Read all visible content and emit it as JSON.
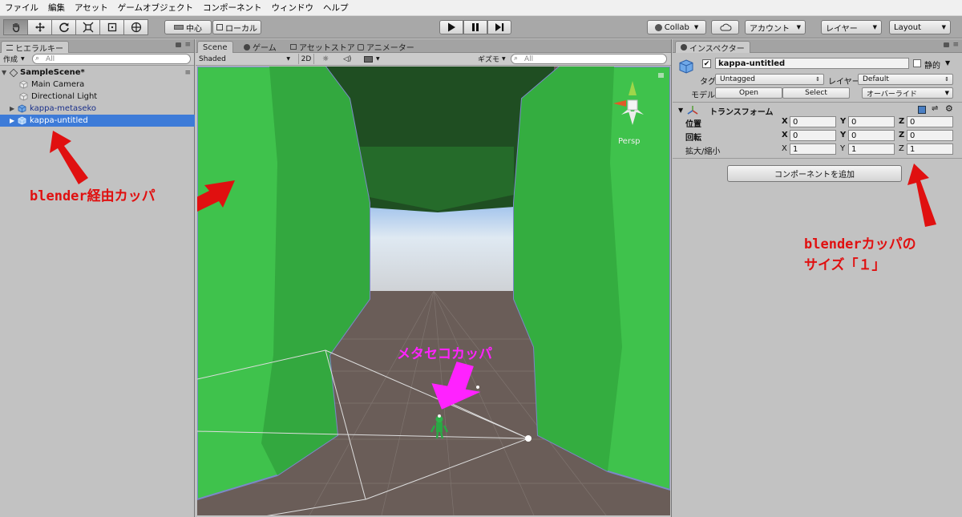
{
  "menu": [
    "ファイル",
    "編集",
    "アセット",
    "ゲームオブジェクト",
    "コンポーネント",
    "ウィンドウ",
    "ヘルプ"
  ],
  "toolbar": {
    "pivot_label": "中心",
    "space_label": "ローカル",
    "collab_label": "Collab",
    "account_label": "アカウント",
    "layers_label": "レイヤー",
    "layout_label": "Layout"
  },
  "hierarchy": {
    "tab_label": "ヒエラルキー",
    "create_label": "作成",
    "search_placeholder": "All",
    "scene_name": "SampleScene*",
    "items": [
      {
        "label": "Main Camera"
      },
      {
        "label": "Directional Light"
      },
      {
        "label": "kappa-metaseko"
      },
      {
        "label": "kappa-untitled"
      }
    ]
  },
  "scene_view": {
    "tabs": [
      "Scene",
      "ゲーム",
      "アセットストア",
      "アニメーター"
    ],
    "shading_mode": "Shaded",
    "mode_2d": "2D",
    "gizmos_label": "ギズモ",
    "search_placeholder": "All",
    "projection_label": "Persp"
  },
  "inspector": {
    "tab_label": "インスペクター",
    "object_name": "kappa-untitled",
    "static_label": "静的",
    "tag_label": "タグ",
    "tag_value": "Untagged",
    "layer_label": "レイヤー",
    "layer_value": "Default",
    "model_label": "モデル",
    "open_label": "Open",
    "select_label": "Select",
    "overrides_label": "オーバーライド",
    "transform": {
      "title": "トランスフォーム",
      "position_label": "位置",
      "rotation_label": "回転",
      "scale_label": "拡大/縮小",
      "position": {
        "x": "0",
        "y": "0",
        "z": "0"
      },
      "rotation": {
        "x": "0",
        "y": "0",
        "z": "0"
      },
      "scale": {
        "x": "1",
        "y": "1",
        "z": "1"
      }
    },
    "add_component_label": "コンポーネントを追加"
  },
  "annotations": {
    "blender_via": "blender経由カッパ",
    "metaseko": "メタセコカッパ",
    "size_line1": "blenderカッパの",
    "size_line2": "サイズ「１」"
  },
  "colors": {
    "annotation_red": "#e01010",
    "annotation_magenta": "#ff22ff",
    "selection_blue": "#3d7bd8",
    "mesh_green": "#3fbf4a"
  }
}
